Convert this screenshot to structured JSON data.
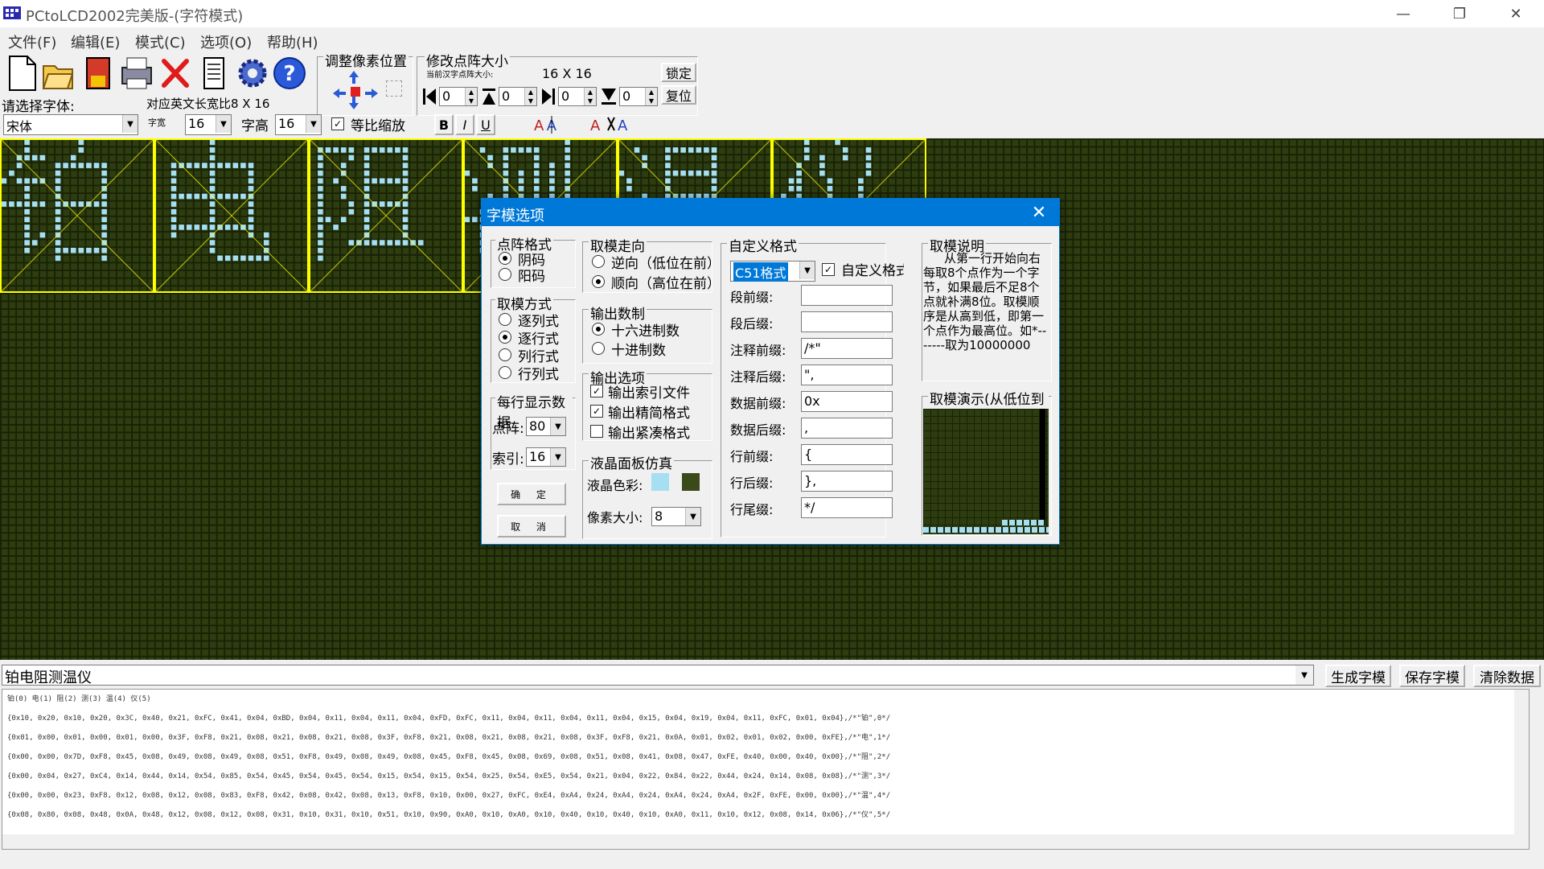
{
  "window": {
    "title": "PCtoLCD2002完美版-(字符模式)",
    "minimize": "—",
    "restore": "❐",
    "close": "✕"
  },
  "menu": [
    "文件(F)",
    "编辑(E)",
    "模式(C)",
    "选项(O)",
    "帮助(H)"
  ],
  "toolbar": {
    "font_label": "请选择字体:",
    "font_value": "宋体",
    "ratio_label": "对应英文长宽比8 X 16",
    "char_width_label": "字宽",
    "char_width": "16",
    "char_height_label": "字高",
    "char_height": "16",
    "proportional_label": "等比缩放",
    "proportional_checked": true,
    "bold": "B",
    "italic": "I",
    "underline": "U",
    "adjust_pixel_label": "调整像素位置",
    "resize_label": "修改点阵大小",
    "current_size_label": "当前汉字点阵大小:",
    "current_size": "16 X 16",
    "lock_button": "锁定",
    "reset_button": "复位",
    "offsets": [
      "0",
      "0",
      "0",
      "0"
    ]
  },
  "canvas": {
    "colors": {
      "background": "#2e3d10",
      "grid": "#182206",
      "pixel": "#a6dff2",
      "guide": "#ffff00"
    }
  },
  "input_text": "铂电阻测温仪",
  "actions": {
    "generate": "生成字模",
    "save": "保存字模",
    "clear": "清除数据"
  },
  "output": {
    "index_line": "铂(0) 电(1) 阻(2) 测(3) 温(4) 仪(5)",
    "lines": [
      "{0x10, 0x20, 0x10, 0x20, 0x3C, 0x40, 0x21, 0xFC, 0x41, 0x04, 0xBD, 0x04, 0x11, 0x04, 0x11, 0x04, 0xFD, 0xFC, 0x11, 0x04, 0x11, 0x04, 0x11, 0x04, 0x15, 0x04, 0x19, 0x04, 0x11, 0xFC, 0x01, 0x04},/*\"铂\",0*/",
      "{0x01, 0x00, 0x01, 0x00, 0x01, 0x00, 0x3F, 0xF8, 0x21, 0x08, 0x21, 0x08, 0x21, 0x08, 0x3F, 0xF8, 0x21, 0x08, 0x21, 0x08, 0x21, 0x08, 0x3F, 0xF8, 0x21, 0x0A, 0x01, 0x02, 0x01, 0x02, 0x00, 0xFE},/*\"电\",1*/",
      "{0x00, 0x00, 0x7D, 0xF8, 0x45, 0x08, 0x49, 0x08, 0x49, 0x08, 0x51, 0xF8, 0x49, 0x08, 0x49, 0x08, 0x45, 0xF8, 0x45, 0x08, 0x69, 0x08, 0x51, 0x08, 0x41, 0x08, 0x47, 0xFE, 0x40, 0x00, 0x40, 0x00},/*\"阻\",2*/",
      "{0x00, 0x04, 0x27, 0xC4, 0x14, 0x44, 0x14, 0x54, 0x85, 0x54, 0x45, 0x54, 0x45, 0x54, 0x15, 0x54, 0x15, 0x54, 0x25, 0x54, 0xE5, 0x54, 0x21, 0x04, 0x22, 0x84, 0x22, 0x44, 0x24, 0x14, 0x08, 0x08},/*\"测\",3*/",
      "{0x00, 0x00, 0x23, 0xF8, 0x12, 0x08, 0x12, 0x08, 0x83, 0xF8, 0x42, 0x08, 0x42, 0x08, 0x13, 0xF8, 0x10, 0x00, 0x27, 0xFC, 0xE4, 0xA4, 0x24, 0xA4, 0x24, 0xA4, 0x24, 0xA4, 0x2F, 0xFE, 0x00, 0x00},/*\"温\",4*/",
      "{0x08, 0x80, 0x08, 0x48, 0x0A, 0x48, 0x12, 0x08, 0x12, 0x08, 0x31, 0x10, 0x31, 0x10, 0x51, 0x10, 0x90, 0xA0, 0x10, 0xA0, 0x10, 0x40, 0x10, 0x40, 0x10, 0xA0, 0x11, 0x10, 0x12, 0x08, 0x14, 0x06},/*\"仪\",5*/"
    ]
  },
  "dialog": {
    "title": "字模选项",
    "dot_format": {
      "title": "点阵格式",
      "options": [
        "阴码",
        "阳码"
      ],
      "selected": 0
    },
    "scan_method": {
      "title": "取模方式",
      "options": [
        "逐列式",
        "逐行式",
        "列行式",
        "行列式"
      ],
      "selected": 1
    },
    "per_line": {
      "title": "每行显示数据",
      "dot_label": "点阵:",
      "dot_value": "80",
      "index_label": "索引:",
      "index_value": "16"
    },
    "ok_button": "确 定",
    "cancel_button": "取 消",
    "direction": {
      "title": "取模走向",
      "options": [
        "逆向（低位在前）",
        "顺向（高位在前）"
      ],
      "selected": 1
    },
    "radix": {
      "title": "输出数制",
      "options": [
        "十六进制数",
        "十进制数"
      ],
      "selected": 0
    },
    "output_options": {
      "title": "输出选项",
      "options": [
        "输出索引文件",
        "输出精简格式",
        "输出紧凑格式"
      ],
      "checked": [
        true,
        true,
        false
      ]
    },
    "lcd_sim": {
      "title": "液晶面板仿真",
      "color_label": "液晶色彩:",
      "pixel_size_label": "像素大小:",
      "pixel_size": "8",
      "color_fg": "#a6dff2",
      "color_bg": "#3a4a1a"
    },
    "custom": {
      "title": "自定义格式",
      "format_value": "C51格式",
      "custom_check_label": "自定义格式",
      "custom_checked": true,
      "fields": [
        {
          "label": "段前缀:",
          "value": ""
        },
        {
          "label": "段后缀:",
          "value": ""
        },
        {
          "label": "注释前缀:",
          "value": "/*\""
        },
        {
          "label": "注释后缀:",
          "value": "\","
        },
        {
          "label": "数据前缀:",
          "value": "0x"
        },
        {
          "label": "数据后缀:",
          "value": ","
        },
        {
          "label": "行前缀:",
          "value": "{"
        },
        {
          "label": "行后缀:",
          "value": "},"
        },
        {
          "label": "行尾缀:",
          "value": "*/"
        }
      ]
    },
    "description": {
      "title": "取模说明",
      "text": "从第一行开始向右每取8个点作为一个字节，如果最后不足8个点就补满8位。取模顺序是从高到低，即第一个点作为最高位。如*-------取为10000000"
    },
    "demo_title": "取模演示(从低位到高位)"
  }
}
